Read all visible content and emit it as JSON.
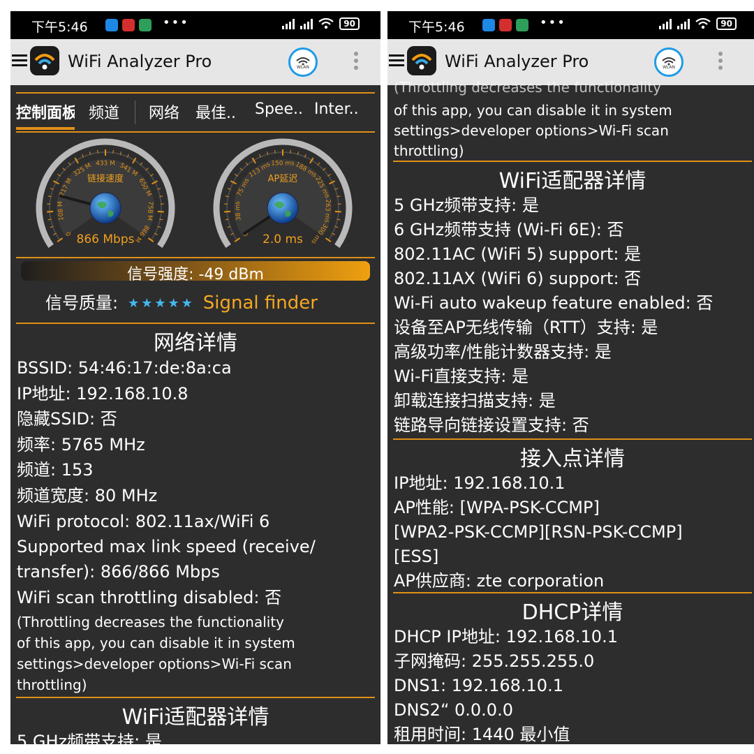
{
  "status": {
    "time": "下午5:46",
    "hd": "HD",
    "battery": "90"
  },
  "app": {
    "title": "WiFi Analyzer Pro",
    "wlan_label": "WLAN"
  },
  "tabs": [
    "控制面板",
    "频道",
    "网络",
    "最佳..",
    "Spee..",
    "Inter.."
  ],
  "gauges": {
    "speed": {
      "title": "链接速度",
      "value": "866 Mbps",
      "ticks": [
        "0",
        "108 M",
        "217 M",
        "325 M",
        "433 M",
        "541 M",
        "650 M",
        "758 M",
        "866 M"
      ],
      "needle_fraction": 0.2
    },
    "latency": {
      "title": "AP延迟",
      "value": "2.0 ms",
      "ticks": [
        "0",
        "38 ms",
        "75 ms",
        "113 ms",
        "150 ms",
        "188 ms",
        "225 ms",
        "263 ms",
        "300 ms"
      ],
      "needle_fraction": 0.006
    }
  },
  "signal": {
    "strength": "信号强度:  -49 dBm",
    "quality_label": "信号质量:",
    "stars": "★★★★★",
    "finder": "Signal finder"
  },
  "left": {
    "network_heading": "网络详情",
    "network_rows": [
      "BSSID:  54:46:17:de:8a:ca",
      "IP地址:  192.168.10.8",
      "隐藏SSID:  否",
      "频率:  5765 MHz",
      "频道:  153",
      "频道宽度: 80 MHz",
      "WiFi protocol: 802.11ax/WiFi 6",
      "Supported max link speed (receive/",
      "transfer): 866/866 Mbps",
      "WiFi scan throttling disabled: 否"
    ],
    "throttle_note": [
      "(Throttling decreases the functionality",
      "of this app, you can disable it in system",
      "settings>developer options>Wi-Fi scan",
      "throttling)"
    ],
    "adapter_heading": "WiFi适配器详情",
    "adapter_partial": "5 GHz频带支持: 是"
  },
  "right": {
    "throttle_note": [
      "(Throttling decreases the functionality",
      "of this app, you can disable it in system",
      "settings>developer options>Wi-Fi scan",
      "throttling)"
    ],
    "adapter_heading": "WiFi适配器详情",
    "adapter_rows": [
      "5 GHz频带支持: 是",
      "6 GHz频带支持 (Wi-Fi 6E): 否",
      "802.11AC (WiFi 5) support: 是",
      "802.11AX (WiFi 6) support: 否",
      "Wi-Fi auto wakeup feature enabled: 否",
      "设备至AP无线传输（RTT）支持: 是",
      "高级功率/性能计数器支持: 是",
      "Wi-Fi直接支持: 是",
      "卸载连接扫描支持: 是",
      "链路导向链接设置支持: 否"
    ],
    "ap_heading": "接入点详情",
    "ap_rows": [
      "IP地址:  192.168.10.1",
      "AP性能:  [WPA-PSK-CCMP]",
      "[WPA2-PSK-CCMP][RSN-PSK-CCMP]",
      "[ESS]",
      "AP供应商:  zte corporation"
    ],
    "dhcp_heading": "DHCP详情",
    "dhcp_rows": [
      "DHCP IP地址:  192.168.10.1",
      "子网掩码:  255.255.255.0",
      "DNS1:  192.168.10.1",
      "DNS2“ 0.0.0.0",
      "租用时间:  1440 最小值"
    ]
  },
  "colors": {
    "accent": "#e09018",
    "panel_bg": "#2d2d2d",
    "appbar_bg": "#e6e6e6",
    "link": "#f5a823",
    "star": "#45b8ee"
  }
}
